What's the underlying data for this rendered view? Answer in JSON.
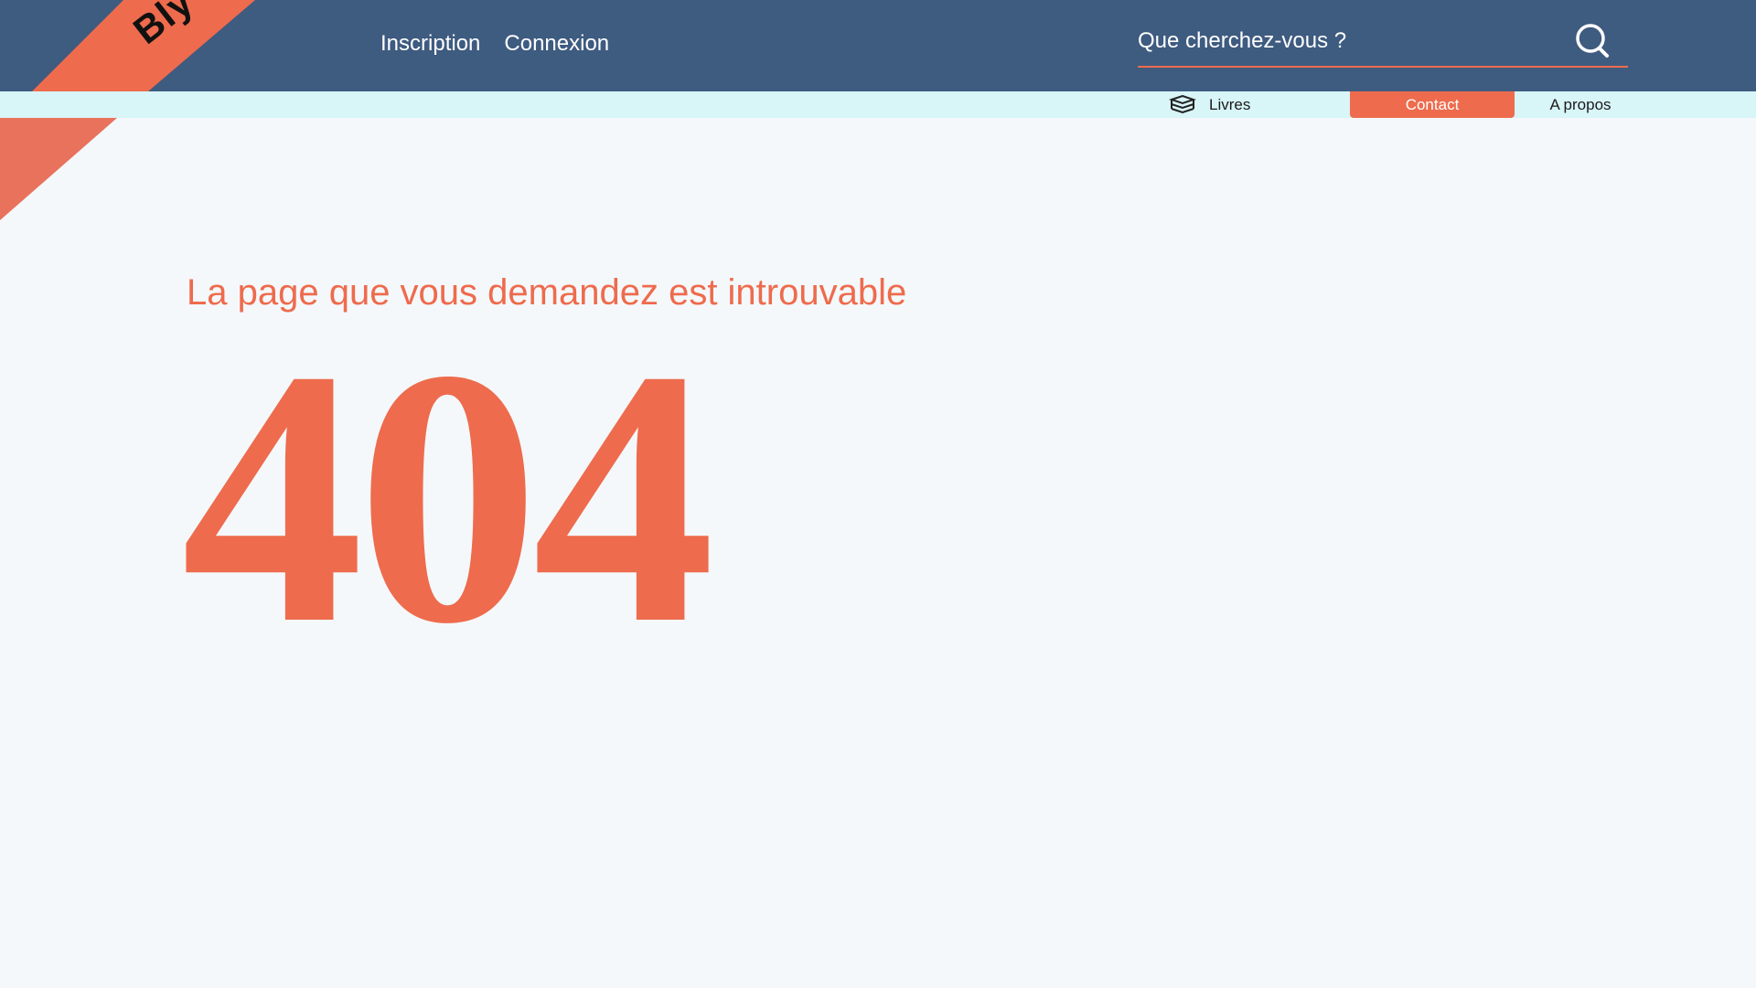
{
  "brand": {
    "logo_text": "Bly"
  },
  "header": {
    "auth_links": [
      {
        "label": "Inscription"
      },
      {
        "label": "Connexion"
      }
    ],
    "search": {
      "placeholder": "Que cherchez-vous ?",
      "value": ""
    }
  },
  "subnav": {
    "items": [
      {
        "label": "Livres",
        "icon": "books-icon"
      },
      {
        "label": "Contact",
        "active": true
      },
      {
        "label": "A propos"
      }
    ]
  },
  "main": {
    "message": "La page que vous demandez est introuvable",
    "code": "404"
  },
  "colors": {
    "header_bg": "#3e5b80",
    "accent": "#ee6b4d",
    "subnav_bg": "#d8f5f8",
    "page_bg": "#f4f8fa"
  }
}
